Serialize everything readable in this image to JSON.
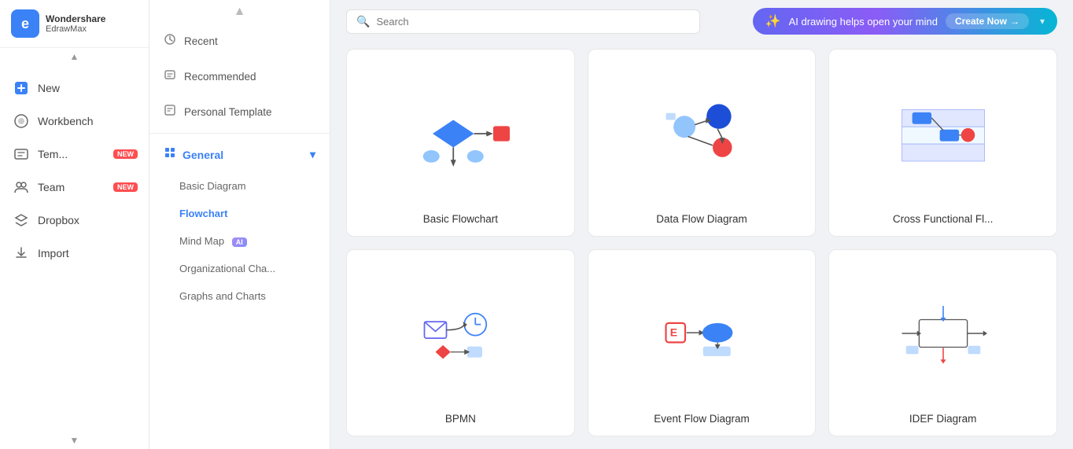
{
  "app": {
    "name_main": "Wondershare",
    "name_sub": "EdrawMax",
    "logo_letter": "e"
  },
  "sidebar": {
    "scroll_up_label": "▲",
    "scroll_down_label": "▼",
    "items": [
      {
        "id": "new",
        "label": "New",
        "icon": "➕",
        "badge": null,
        "active": false
      },
      {
        "id": "workbench",
        "label": "Workbench",
        "icon": "🖥",
        "badge": null,
        "active": false
      },
      {
        "id": "templates",
        "label": "Tem...",
        "icon": "💬",
        "badge": "NEW",
        "active": false
      },
      {
        "id": "team",
        "label": "Team",
        "icon": "👥",
        "badge": "NEW",
        "active": false
      },
      {
        "id": "dropbox",
        "label": "Dropbox",
        "icon": "📦",
        "badge": null,
        "active": false
      },
      {
        "id": "import",
        "label": "Import",
        "icon": "📥",
        "badge": null,
        "active": false
      }
    ]
  },
  "menu": {
    "recent_label": "Recent",
    "recommended_label": "Recommended",
    "personal_template_label": "Personal Template",
    "general_label": "General",
    "basic_diagram_label": "Basic Diagram",
    "flowchart_label": "Flowchart",
    "mind_map_label": "Mind Map",
    "org_chart_label": "Organizational Cha...",
    "graphs_charts_label": "Graphs and Charts"
  },
  "topbar": {
    "search_placeholder": "Search",
    "ai_banner_text": "AI drawing helps open your mind",
    "ai_banner_btn": "Create Now",
    "ai_banner_arrow": "→",
    "dropdown_arrow": "▾"
  },
  "templates": {
    "cards": [
      {
        "id": "basic-flowchart",
        "label": "Basic Flowchart"
      },
      {
        "id": "data-flow-diagram",
        "label": "Data Flow Diagram"
      },
      {
        "id": "cross-functional",
        "label": "Cross Functional Fl..."
      },
      {
        "id": "bpmn",
        "label": "BPMN"
      },
      {
        "id": "event-flow-diagram",
        "label": "Event Flow Diagram"
      },
      {
        "id": "idef-diagram",
        "label": "IDEF Diagram"
      }
    ]
  }
}
